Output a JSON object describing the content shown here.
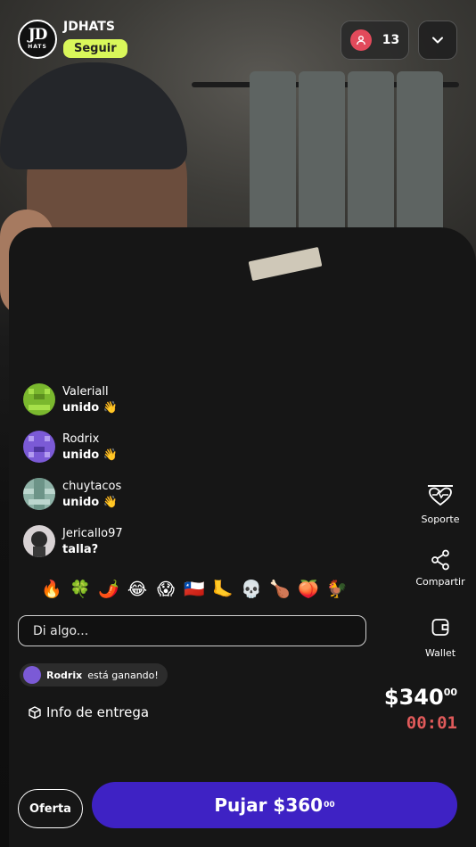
{
  "seller": {
    "logo_main": "JD",
    "logo_sub": "HATS",
    "name": "JDHATS",
    "follow_label": "Seguir"
  },
  "viewers": {
    "count": "13",
    "icon": "person-icon"
  },
  "chat": [
    {
      "user": "Valeriall",
      "text": "unido 👋",
      "avatar_color": "#7ab82e"
    },
    {
      "user": "Rodrix",
      "text": "unido 👋",
      "avatar_color": "#7b5ad6"
    },
    {
      "user": "chuytacos",
      "text": "unido 👋",
      "avatar_color": "#8fb3a8"
    },
    {
      "user": "Jericallo97",
      "text": "talla?",
      "avatar_color": "#9a8d93"
    }
  ],
  "emojis": [
    "🔥",
    "🍀",
    "🌶️",
    "😂",
    "😱",
    "🇨🇱",
    "🦶",
    "💀",
    "🍗",
    "🍑",
    "🐓"
  ],
  "input": {
    "placeholder": "Di algo..."
  },
  "winner": {
    "user": "Rodrix",
    "text": "está ganando!"
  },
  "delivery_label": "Info de entrega",
  "actions": {
    "support": "Soporte",
    "share": "Compartir",
    "wallet": "Wallet"
  },
  "auction": {
    "price": "$340",
    "price_cents": "00",
    "timer": "00:01"
  },
  "bottom": {
    "offer_label": "Oferta",
    "bid_label": "Pujar $360",
    "bid_cents": "00"
  },
  "colors": {
    "accent_follow": "#d9f75a",
    "bid_button": "#3e22c4",
    "timer": "#e05a5a",
    "viewer_badge": "#e24a5b"
  }
}
